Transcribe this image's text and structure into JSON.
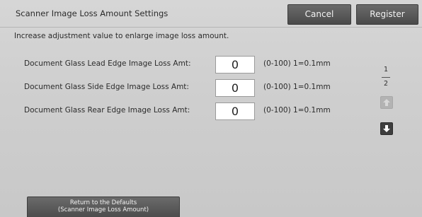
{
  "header": {
    "title": "Scanner Image Loss Amount Settings",
    "cancel_label": "Cancel",
    "register_label": "Register"
  },
  "instruction": "Increase adjustment value to enlarge image loss amount.",
  "rows": [
    {
      "label": "Document Glass Lead Edge Image Loss Amt:",
      "value": "0",
      "range": "(0-100) 1=0.1mm"
    },
    {
      "label": "Document Glass Side Edge Image Loss Amt:",
      "value": "0",
      "range": "(0-100) 1=0.1mm"
    },
    {
      "label": "Document Glass Rear Edge Image Loss Amt:",
      "value": "0",
      "range": "(0-100) 1=0.1mm"
    }
  ],
  "pager": {
    "current": "1",
    "total": "2",
    "up_icon": "arrow-up-icon",
    "down_icon": "arrow-down-icon",
    "up_enabled": false,
    "down_enabled": true
  },
  "footer": {
    "defaults_line1": "Return to the Defaults",
    "defaults_line2": "(Scanner Image Loss Amount)"
  },
  "colors": {
    "background": "#c9c9c9",
    "button": "#555555",
    "button_text": "#f2f2f2",
    "input_bg": "#ffffff"
  }
}
